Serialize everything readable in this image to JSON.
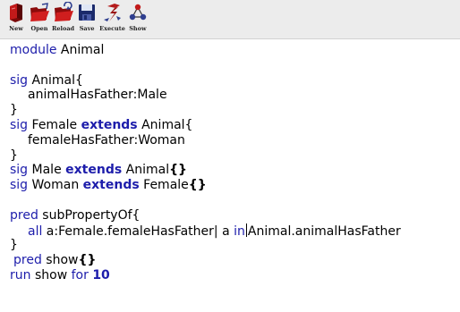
{
  "toolbar": {
    "buttons": [
      {
        "label": "New",
        "icon": "new-icon"
      },
      {
        "label": "Open",
        "icon": "open-icon"
      },
      {
        "label": "Reload",
        "icon": "reload-icon"
      },
      {
        "label": "Save",
        "icon": "save-icon"
      },
      {
        "label": "Execute",
        "icon": "execute-icon"
      },
      {
        "label": "Show",
        "icon": "show-icon"
      }
    ]
  },
  "editor": {
    "lines": [
      {
        "segments": [
          {
            "t": "module",
            "kw": true
          },
          {
            "t": " Animal"
          }
        ]
      },
      {
        "segments": []
      },
      {
        "segments": [
          {
            "t": "sig",
            "kw": true
          },
          {
            "t": " Animal{"
          }
        ]
      },
      {
        "indent": 1,
        "segments": [
          {
            "t": "animalHasFather:Male"
          }
        ]
      },
      {
        "segments": [
          {
            "t": "}"
          }
        ]
      },
      {
        "segments": [
          {
            "t": "sig",
            "kw": true
          },
          {
            "t": " Female "
          },
          {
            "t": "extends",
            "kw": true,
            "bold": true
          },
          {
            "t": " Animal{"
          }
        ]
      },
      {
        "indent": 1,
        "segments": [
          {
            "t": "femaleHasFather:Woman"
          }
        ]
      },
      {
        "segments": [
          {
            "t": "}"
          }
        ]
      },
      {
        "segments": [
          {
            "t": "sig",
            "kw": true
          },
          {
            "t": " Male "
          },
          {
            "t": "extends",
            "kw": true,
            "bold": true
          },
          {
            "t": " Animal"
          },
          {
            "t": "{}",
            "bold": true
          }
        ]
      },
      {
        "segments": [
          {
            "t": "sig",
            "kw": true
          },
          {
            "t": " Woman "
          },
          {
            "t": "extends",
            "kw": true,
            "bold": true
          },
          {
            "t": " Female"
          },
          {
            "t": "{}",
            "bold": true
          }
        ]
      },
      {
        "segments": []
      },
      {
        "segments": [
          {
            "t": "pred",
            "kw": true
          },
          {
            "t": " subPropertyOf{"
          }
        ]
      },
      {
        "indent": 1,
        "segments": [
          {
            "t": "all",
            "kw": true
          },
          {
            "t": " a:Female.femaleHasFather| a "
          },
          {
            "t": "in",
            "kw": true
          },
          {
            "caret": true
          },
          {
            "t": "Animal.animalHasFather"
          }
        ]
      },
      {
        "segments": [
          {
            "t": "}"
          }
        ]
      },
      {
        "indent": 2,
        "segments": [
          {
            "t": "pred",
            "kw": true
          },
          {
            "t": " show"
          },
          {
            "t": "{}",
            "bold": true
          }
        ]
      },
      {
        "segments": [
          {
            "t": "run",
            "kw": true
          },
          {
            "t": " show "
          },
          {
            "t": "for",
            "kw": true
          },
          {
            "t": " "
          },
          {
            "t": "10",
            "kw": true,
            "bold": true
          }
        ]
      }
    ]
  }
}
